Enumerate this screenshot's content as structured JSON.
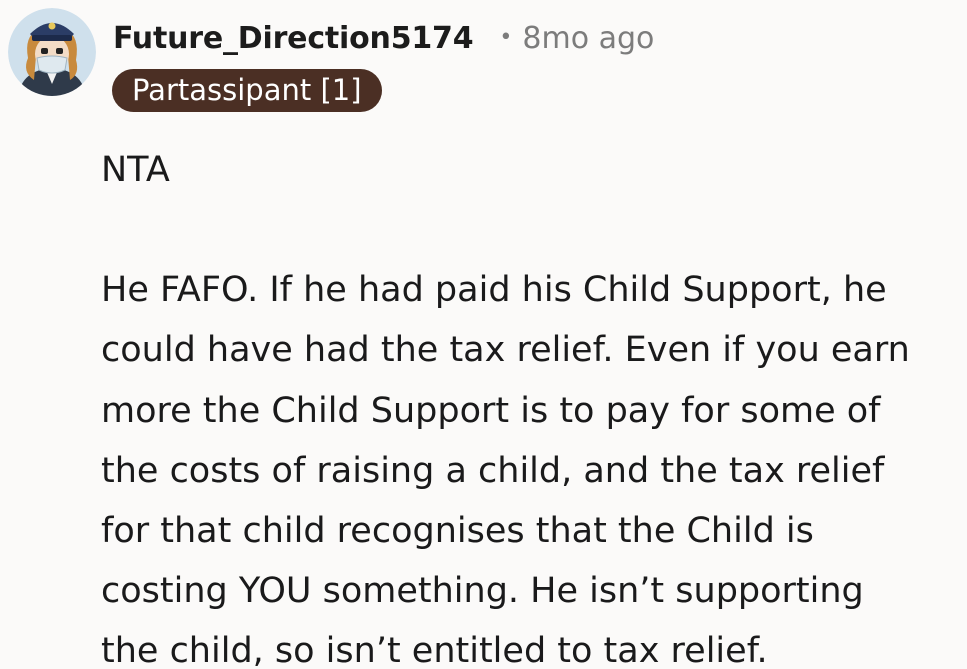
{
  "comment": {
    "author": "Future_Direction5174",
    "separator": "•",
    "time_ago": "8mo ago",
    "flair": "Partassipant [1]",
    "paragraphs": [
      [
        "NTA"
      ],
      [
        "He FAFO. If he had paid his Child Support, he",
        "could have had the tax relief. Even if you earn",
        "more the Child Support is to pay for some of",
        "the costs of raising a child, and the tax relief",
        "for that child recognises that the Child is",
        "costing YOU something. He isn’t supporting",
        "the child, so isn’t entitled to tax relief."
      ]
    ]
  }
}
